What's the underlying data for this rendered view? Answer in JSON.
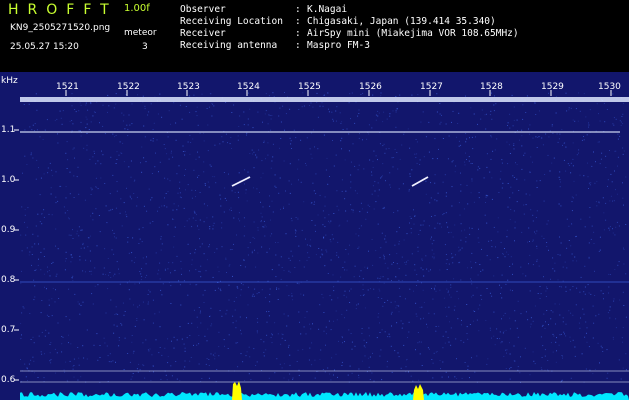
{
  "header": {
    "app_title": "HROFFT",
    "version": "1.00f",
    "file_name": "KN9_2505271520.png",
    "date_time": "25.05.27 15:20",
    "mode_label": "meteor",
    "mode_value": "3"
  },
  "station": {
    "rows": [
      {
        "label": "Observer",
        "sep": ":",
        "value": "K.Nagai"
      },
      {
        "label": "Receiving Location",
        "sep": ":",
        "value": "Chigasaki, Japan (139.414 35.340)"
      },
      {
        "label": "Receiver",
        "sep": ":",
        "value": "AirSpy mini (Miakejima VOR 108.65MHz)"
      },
      {
        "label": "Receiving antenna",
        "sep": ":",
        "value": "Maspro FM-3"
      }
    ]
  },
  "spectrogram": {
    "unit_label": "kHz",
    "time_ticks": [
      "1521",
      "1522",
      "1523",
      "1524",
      "1525",
      "1526",
      "1527",
      "1528",
      "1529",
      "1530"
    ],
    "freq_ticks": [
      "1.1",
      "1.0",
      "0.9",
      "0.8",
      "0.7",
      "0.6"
    ],
    "colors": {
      "background": "#12166c",
      "noise": "#3a5cd8",
      "carrier": "#dfe8ff",
      "trace": "#f0f0ff",
      "level": "#00e8ff",
      "peak": "#ffff00",
      "label": "#ffffff",
      "title": "#c8ff30"
    }
  }
}
